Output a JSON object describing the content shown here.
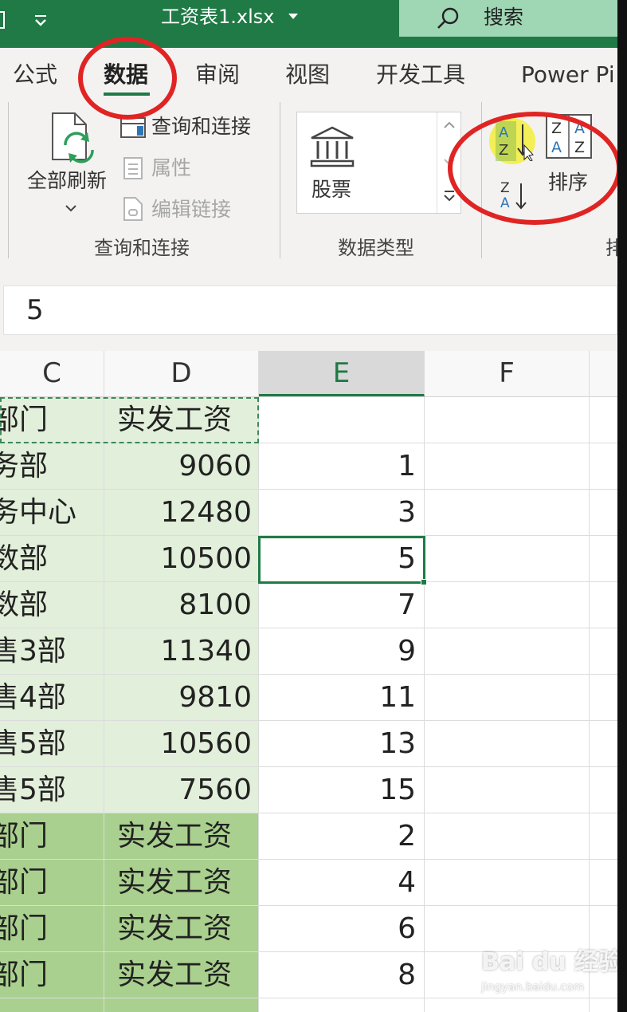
{
  "titlebar": {
    "file_title": "工资表1.xlsx",
    "search_label": "搜索",
    "bg_color": "#1f7a46"
  },
  "ribbon": {
    "tabs": [
      {
        "label": "公式",
        "active": false
      },
      {
        "label": "数据",
        "active": true
      },
      {
        "label": "审阅",
        "active": false
      },
      {
        "label": "视图",
        "active": false
      },
      {
        "label": "开发工具",
        "active": false
      },
      {
        "label": "Power Pi",
        "active": false
      }
    ],
    "query_group": {
      "refresh_all_label": "全部刷新",
      "queries_connections_label": "查询和连接",
      "properties_label": "属性",
      "edit_links_label": "编辑链接",
      "group_label": "查询和连接"
    },
    "data_type_group": {
      "stocks_label": "股票",
      "group_label": "数据类型"
    },
    "sort_group": {
      "sort_label": "排序",
      "group_label_partial": "排"
    }
  },
  "formula_bar": {
    "value": "5"
  },
  "columns": [
    "C",
    "D",
    "E",
    "F"
  ],
  "selected_column": "E",
  "rows": [
    {
      "c": "部门",
      "d": "实发工资",
      "e": "",
      "style": "header-light"
    },
    {
      "c": "务部",
      "d": "9060",
      "e": "1",
      "style": "light"
    },
    {
      "c": "务中心",
      "d": "12480",
      "e": "3",
      "style": "light"
    },
    {
      "c": "数部",
      "d": "10500",
      "e": "5",
      "style": "light"
    },
    {
      "c": "数部",
      "d": "8100",
      "e": "7",
      "style": "light"
    },
    {
      "c": "售3部",
      "d": "11340",
      "e": "9",
      "style": "light"
    },
    {
      "c": "售4部",
      "d": "9810",
      "e": "11",
      "style": "light"
    },
    {
      "c": "售5部",
      "d": "10560",
      "e": "13",
      "style": "light"
    },
    {
      "c": "售5部",
      "d": "7560",
      "e": "15",
      "style": "light"
    },
    {
      "c": "部门",
      "d": "实发工资",
      "e": "2",
      "style": "dark"
    },
    {
      "c": "部门",
      "d": "实发工资",
      "e": "4",
      "style": "dark"
    },
    {
      "c": "部门",
      "d": "实发工资",
      "e": "6",
      "style": "dark"
    },
    {
      "c": "部门",
      "d": "实发工资",
      "e": "8",
      "style": "dark"
    }
  ],
  "active_cell": "E4",
  "watermark": {
    "main": "Bai du 经验",
    "sub": "jingyan.baidu.com"
  }
}
